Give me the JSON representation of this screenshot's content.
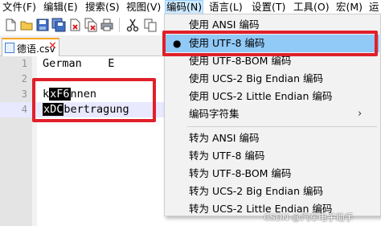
{
  "menubar": {
    "items": [
      "文件(F)",
      "编辑(E)",
      "搜索(S)",
      "视图(V)",
      "编码(N)",
      "语言(L)",
      "设置(T)",
      "工具(O)",
      "宏(M)",
      "运"
    ]
  },
  "toolbar": {
    "icons": [
      "new-file-icon",
      "open-file-icon",
      "save-icon",
      "save-all-icon",
      "close-icon",
      "close-all-icon",
      "print-icon",
      "cut-icon",
      "copy-icon"
    ]
  },
  "tab": {
    "label": "德语.csv",
    "close": "✕"
  },
  "editor": {
    "lines": [
      {
        "num": "1",
        "text": "German    E"
      },
      {
        "num": "2",
        "text": ""
      },
      {
        "num": "3",
        "pre": "k",
        "ctrl": "xF6",
        "post": "nnen"
      },
      {
        "num": "4",
        "pre": "",
        "ctrl": "xDC",
        "post": "bertragung"
      }
    ]
  },
  "encoding_menu": {
    "items": [
      {
        "label": "使用 ANSI 编码"
      },
      {
        "label": "使用 UTF-8 编码",
        "bullet": "●"
      },
      {
        "label": "使用 UTF-8-BOM 编码"
      },
      {
        "label": "使用 UCS-2 Big Endian 编码"
      },
      {
        "label": "使用 UCS-2 Little Endian 编码"
      },
      {
        "label": "编码字符集",
        "arrow": "›"
      },
      {
        "label": "转为 ANSI 编码"
      },
      {
        "label": "转为 UTF-8 编码"
      },
      {
        "label": "转为 UTF-8-BOM 编码"
      },
      {
        "label": "转为 UCS-2 Big Endian 编码"
      },
      {
        "label": "转为 UCS-2 Little Endian 编码"
      }
    ]
  },
  "watermark": "CSDN @汽车电子助手",
  "colors": {
    "highlight_red": "#e0202a",
    "menu_selected": "#91c9f7",
    "current_line": "#e8e8ff",
    "tab_accent": "#f5a623"
  }
}
